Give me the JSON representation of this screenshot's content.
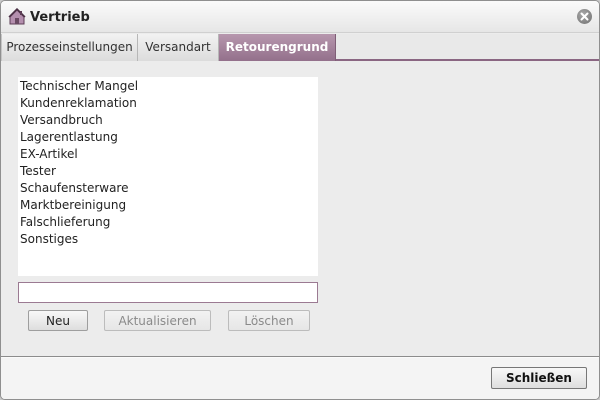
{
  "window": {
    "title": "Vertrieb",
    "icon": "vertrieb-app-icon"
  },
  "tabs": [
    {
      "label": "Prozesseinstellungen",
      "active": false
    },
    {
      "label": "Versandart",
      "active": false
    },
    {
      "label": "Retourengrund",
      "active": true
    }
  ],
  "list": {
    "items": [
      "Technischer Mangel",
      "Kundenreklamation",
      "Versandbruch",
      "Lagerentlastung",
      "EX-Artikel",
      "Tester",
      "Schaufensterware",
      "Marktbereinigung",
      "Falschlieferung",
      "Sonstiges"
    ]
  },
  "input": {
    "value": ""
  },
  "buttons": {
    "neu": "Neu",
    "aktualisieren": "Aktualisieren",
    "loeschen": "Löschen",
    "schliessen": "Schließen"
  },
  "colors": {
    "accent": "#93708b",
    "accent_light": "#b797ae",
    "input_border": "#9b7a92"
  }
}
